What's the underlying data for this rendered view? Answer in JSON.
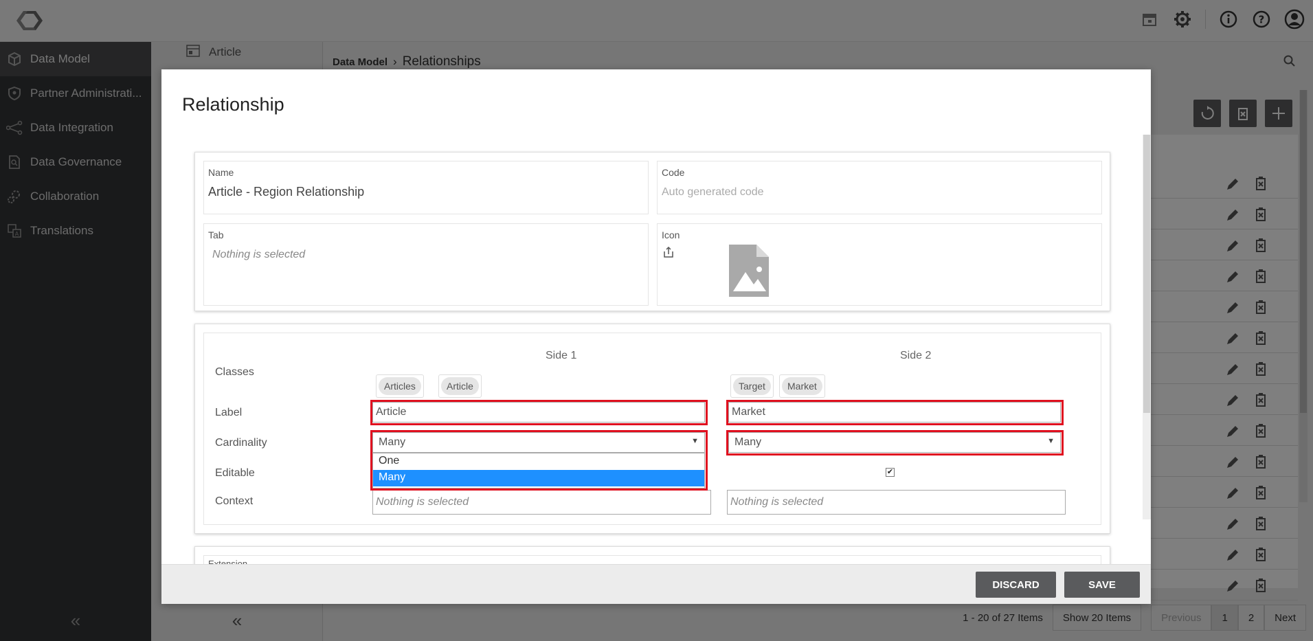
{
  "header": {
    "icons": [
      "logo-icon",
      "calendar-icon",
      "gear-icon",
      "info-icon",
      "help-icon",
      "user-icon"
    ]
  },
  "sidebar": {
    "items": [
      {
        "label": "Data Model",
        "icon": "cube-icon"
      },
      {
        "label": "Partner Administrati...",
        "icon": "shield-icon"
      },
      {
        "label": "Data Integration",
        "icon": "share-icon"
      },
      {
        "label": "Data Governance",
        "icon": "document-search-icon"
      },
      {
        "label": "Collaboration",
        "icon": "gears-icon"
      },
      {
        "label": "Translations",
        "icon": "translate-icon"
      }
    ],
    "collapse": "«"
  },
  "subnav": {
    "item": "Article",
    "collapse": "«"
  },
  "main": {
    "breadcrumb": {
      "parent": "Data Model",
      "sep": "›",
      "current": "Relationships"
    },
    "pager": {
      "summary": "1 - 20 of 27 Items",
      "show": "Show 20 Items",
      "previous": "Previous",
      "page1": "1",
      "page2": "2",
      "next": "Next"
    }
  },
  "modal": {
    "title": "Relationship",
    "name": {
      "label": "Name",
      "value": "Article - Region Relationship"
    },
    "code": {
      "label": "Code",
      "placeholder": "Auto generated code"
    },
    "tab": {
      "label": "Tab",
      "placeholder": "Nothing is selected"
    },
    "icon": {
      "label": "Icon"
    },
    "sides": {
      "side1_title": "Side 1",
      "side2_title": "Side 2",
      "labels": {
        "classes": "Classes",
        "label": "Label",
        "cardinality": "Cardinality",
        "editable": "Editable",
        "context": "Context"
      },
      "side1": {
        "classes": [
          "Articles",
          "Article"
        ],
        "label": "Article",
        "cardinality": "Many",
        "context_placeholder": "Nothing is selected",
        "dropdown_options": [
          "One",
          "Many"
        ],
        "dropdown_selected": "Many"
      },
      "side2": {
        "classes": [
          "Target",
          "Market"
        ],
        "label": "Market",
        "cardinality": "Many",
        "editable": true,
        "context_placeholder": "Nothing is selected"
      }
    },
    "extension_label": "Extension",
    "buttons": {
      "discard": "DISCARD",
      "save": "SAVE"
    }
  },
  "colors": {
    "sidebar_bg": "#333436",
    "button_bg": "#5a5b5d",
    "highlight_red": "#e0101f",
    "selected_option": "#1e90ff"
  }
}
